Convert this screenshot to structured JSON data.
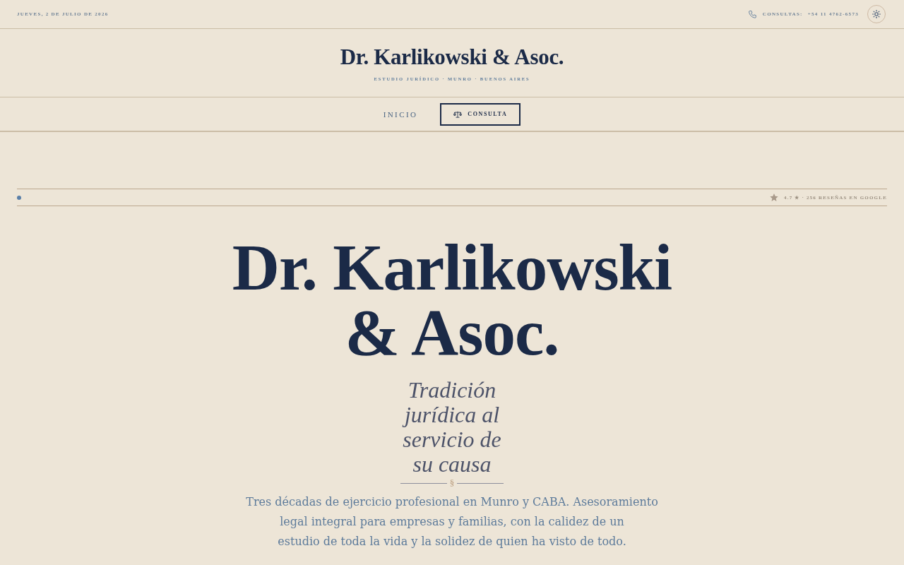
{
  "top_bar": {
    "date": "JUEVES, 2 DE JULIO DE 2026",
    "contact_label": "CONSULTAS:",
    "phone": "+54 11 4762-6573"
  },
  "header": {
    "title": "Dr. Karlikowski & Asoc.",
    "subtitle": "ESTUDIO JURÍDICO · MUNRO · BUENOS AIRES"
  },
  "nav": {
    "links": [
      "INICIO"
    ],
    "cta": "CONSULTA"
  },
  "rating": "4.7 ★ · 256 RESEÑAS EN GOOGLE",
  "hero": {
    "title": "Dr. Karlikowski & Asoc.",
    "tagline": "Tradición jurídica al servicio de su causa",
    "ornament": "§",
    "description": "Tres décadas de ejercicio profesional en Munro y CABA. Asesoramiento legal integral para empresas y familias, con la calidez de un estudio de toda la vida y la solidez de quien ha visto de todo."
  }
}
